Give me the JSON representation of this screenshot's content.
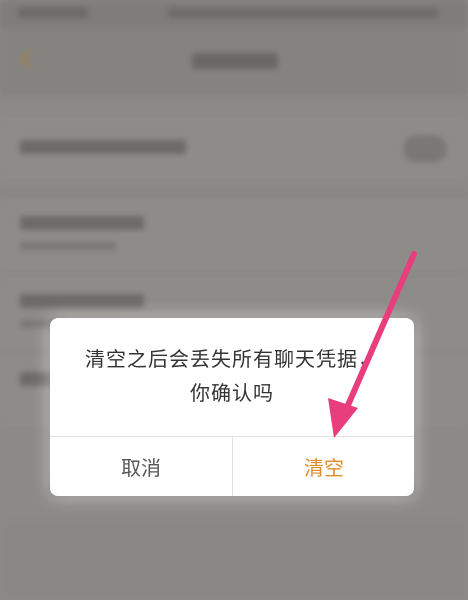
{
  "dialog": {
    "message": "清空之后会丢失所有聊天凭据，你确认吗",
    "cancel_label": "取消",
    "confirm_label": "清空"
  },
  "colors": {
    "confirm_text": "#e08a2a",
    "cancel_text": "#555555",
    "annotation_arrow": "#e83e7e",
    "back_icon": "#a8803a"
  },
  "icons": {
    "back": "back-arrow-icon",
    "annotation": "pink-arrow-annotation"
  }
}
